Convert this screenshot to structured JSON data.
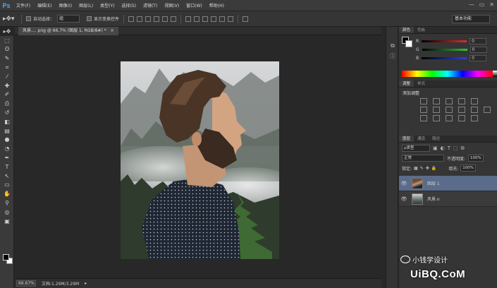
{
  "app": {
    "logo": "Ps"
  },
  "menu": [
    "文件(F)",
    "编辑(E)",
    "图像(I)",
    "图层(L)",
    "类型(Y)",
    "选择(S)",
    "滤镜(T)",
    "视图(V)",
    "窗口(W)",
    "帮助(H)"
  ],
  "window_controls": {
    "minimize": "—",
    "restore": "▭",
    "close": "✕"
  },
  "options": {
    "auto_select_label": "自动选择：",
    "auto_select_value": "组",
    "show_transform_label": "显示变换控件",
    "workspace": "基本功能"
  },
  "toolbar": {
    "tools": [
      "move-tool",
      "marquee-tool",
      "lasso-tool",
      "quick-select-tool",
      "crop-tool",
      "eyedropper-tool",
      "healing-tool",
      "brush-tool",
      "clone-stamp-tool",
      "history-brush-tool",
      "eraser-tool",
      "gradient-tool",
      "blur-tool",
      "dodge-tool",
      "pen-tool",
      "type-tool",
      "path-select-tool",
      "shape-tool",
      "hand-tool",
      "zoom-tool",
      "quick-mask-tool",
      "screen-mode-tool"
    ],
    "glyphs": [
      "▸✥",
      "⬚",
      "ʘ",
      "✎",
      "⌗",
      "⁄",
      "✚",
      "✐",
      "⎙",
      "↺",
      "◧",
      "▤",
      "●",
      "◔",
      "✒",
      "T",
      "↖",
      "▭",
      "✋",
      "⚲",
      "◎",
      "▣"
    ]
  },
  "document": {
    "tab_title": "风景.... png @ 66.7% (图层 1, RGB/8#) *",
    "tab_close": "×",
    "zoom": "66.67%",
    "doc_info": "文档:1.29M/3.29M"
  },
  "color_panel": {
    "tabs": [
      "颜色",
      "色板"
    ],
    "channels": [
      {
        "label": "R",
        "value": "0",
        "color": "#e22b2b"
      },
      {
        "label": "G",
        "value": "0",
        "color": "#2ec43a"
      },
      {
        "label": "B",
        "value": "0",
        "color": "#2b3fe2"
      }
    ]
  },
  "adjustments_panel": {
    "tabs": [
      "调整",
      "样式"
    ],
    "title": "添加调整"
  },
  "layers_panel": {
    "tabs": [
      "图层",
      "通道",
      "路径"
    ],
    "filter_kind": "ρ类型",
    "blend_mode": "正常",
    "opacity_label": "不透明度:",
    "opacity_value": "100%",
    "lock_label": "锁定:",
    "fill_label": "填充:",
    "fill_value": "100%",
    "layers": [
      {
        "name": "图层 1",
        "selected": true,
        "visible": true
      },
      {
        "name": "风景.o",
        "selected": false,
        "visible": true
      }
    ],
    "eye_glyph": "👁"
  },
  "watermark": {
    "line1": "小钱学设计",
    "line2": "UiBQ.CoM"
  },
  "colors": {
    "accent": "#4aa8ff",
    "selected_layer": "#5a6c8a",
    "foreground": "#000000",
    "background": "#ffffff"
  }
}
